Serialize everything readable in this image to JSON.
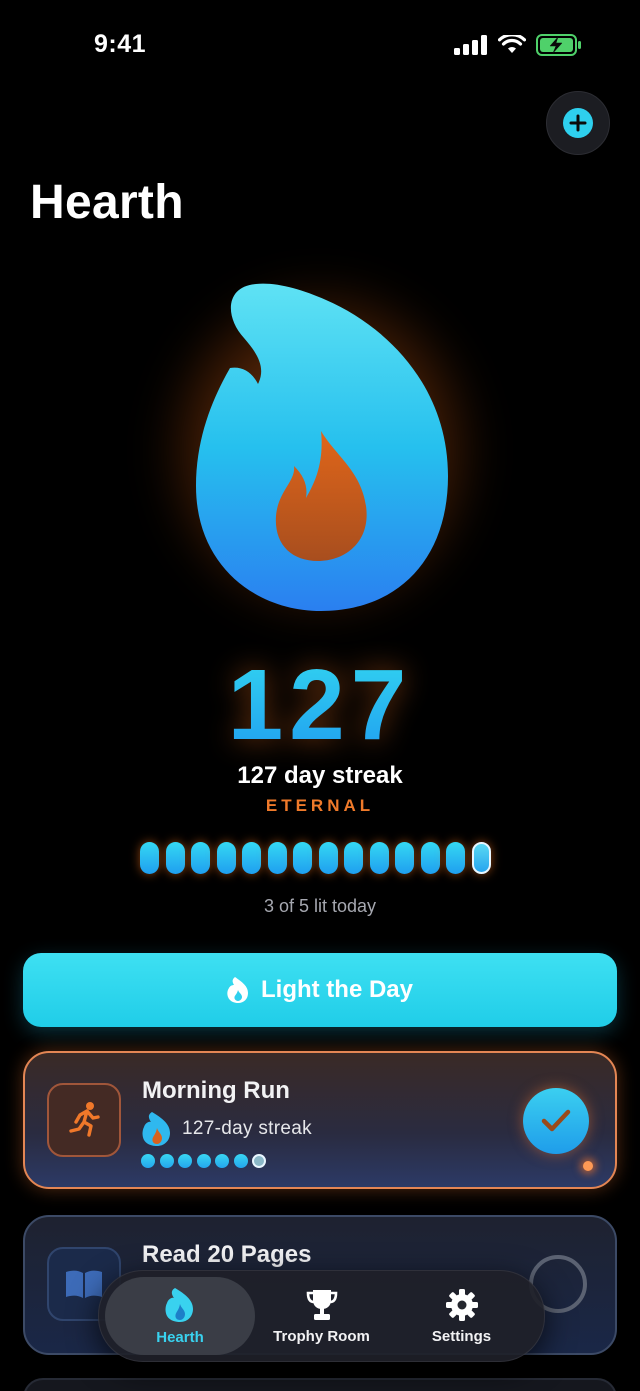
{
  "status": {
    "time": "9:41"
  },
  "header": {
    "title": "Hearth",
    "add_icon": "plus-icon"
  },
  "hero": {
    "streak_number": "127",
    "streak_label": "127 day streak",
    "tier": "ETERNAL",
    "pills_total": 14,
    "pills_current_index": 13,
    "lit_today": "3 of 5 lit today"
  },
  "cta": {
    "label": "Light the Day",
    "icon": "flame-icon"
  },
  "habits": [
    {
      "name": "Morning Run",
      "icon": "runner-icon",
      "streak": "127-day streak",
      "done": true
    },
    {
      "name": "Read 20 Pages",
      "icon": "book-icon",
      "streak": "",
      "done": false
    }
  ],
  "tabs": [
    {
      "label": "Hearth",
      "icon": "flame-icon",
      "active": true
    },
    {
      "label": "Trophy Room",
      "icon": "trophy-icon",
      "active": false
    },
    {
      "label": "Settings",
      "icon": "gear-icon",
      "active": false
    }
  ],
  "colors": {
    "accent": "#2ed0ee",
    "flame_inner": "#c85a1a",
    "tier": "#f07a2a"
  }
}
